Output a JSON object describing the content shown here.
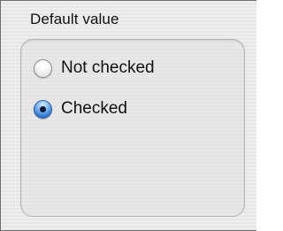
{
  "group": {
    "title": "Default value",
    "options": [
      {
        "label": "Not checked",
        "selected": false
      },
      {
        "label": "Checked",
        "selected": true
      }
    ]
  },
  "colors": {
    "accent": "#2e78d4",
    "panel_background": "#ececec"
  }
}
